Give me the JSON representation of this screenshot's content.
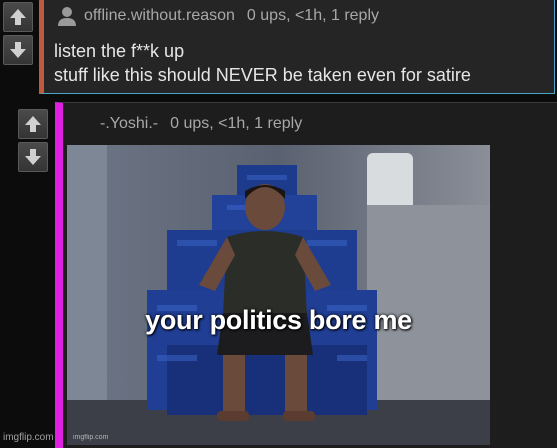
{
  "comment1": {
    "username": "offline.without.reason",
    "stats": "0 ups, <1h, 1 reply",
    "lines": [
      "listen the f**k up",
      "stuff like this should NEVER be taken even for satire"
    ]
  },
  "comment2": {
    "username": "-.Yoshi.-",
    "stats": "0 ups, <1h, 1 reply",
    "meme": {
      "caption": "your politics bore me",
      "watermark": "imgflip.com"
    }
  },
  "footer": {
    "watermark": "imgflip.com"
  },
  "icons": {
    "upvote": "up-arrow",
    "downvote": "down-arrow",
    "user": "user-silhouette"
  },
  "colors": {
    "comment1_accent": "#c05a3c",
    "comment1_border": "#4aa8c8",
    "comment2_accent": "#e020e0"
  }
}
